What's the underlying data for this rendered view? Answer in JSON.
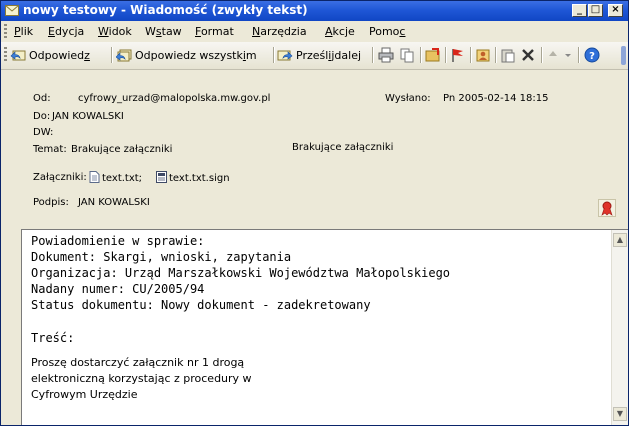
{
  "window": {
    "title": "nowy testowy - Wiadomość (zwykły tekst)",
    "controls": {
      "minimize": "_",
      "maximize": "□",
      "close": "×"
    }
  },
  "menu": [
    {
      "key": "P",
      "rest": "lik"
    },
    {
      "key": "E",
      "rest": "dycja"
    },
    {
      "key": "W",
      "rest": "idok"
    },
    {
      "pre": "W",
      "key": "s",
      "rest": "taw"
    },
    {
      "key": "F",
      "rest": "ormat"
    },
    {
      "key": "N",
      "rest": "arzędzia"
    },
    {
      "key": "A",
      "rest": "kcje"
    },
    {
      "pre": "Pomo",
      "key": "c",
      "rest": ""
    }
  ],
  "toolbar": {
    "reply": {
      "pre": "Odpowied",
      "key": "z",
      "rest": ""
    },
    "reply_all": {
      "pre": "Odpowiedz wszystk",
      "key": "i",
      "rest": "m"
    },
    "forward": {
      "pre": "Prześl",
      "key": "ij",
      "rest": " dalej"
    }
  },
  "header": {
    "from_label": "Od:",
    "from_value": "cyfrowy_urzad@malopolska.mw.gov.pl",
    "sent_label": "Wysłano:",
    "sent_value": "Pn 2005-02-14 18:15",
    "to_label": "Do:",
    "to_value": "JAN KOWALSKI",
    "cc_label": "DW:",
    "subject_label": "Temat:",
    "subject_value": "Brakujące załączniki",
    "subject_note": "Brakujące załączniki",
    "attachments_label": "Załączniki:",
    "attachments": [
      "text.txt;",
      "text.txt.sign"
    ],
    "signature_label": "Podpis:",
    "signature_value": "JAN KOWALSKI"
  },
  "body": {
    "lines": [
      "Powiadomienie w sprawie:",
      "Dokument: Skargi, wnioski, zapytania",
      "Organizacja: Urząd Marszałkowski Województwa Małopolskiego",
      "Nadany numer: CU/2005/94",
      "Status dokumentu: Nowy dokument - zadekretowany"
    ],
    "content_label": "Treść:",
    "content_lines": [
      "Proszę dostarczyć załącznik nr 1 drogą",
      "elektroniczną korzystając z procedury w",
      "Cyfrowym Urzędzie"
    ]
  },
  "colors": {
    "titlebar": "#1f57d6",
    "chrome": "#ece9d8",
    "accent_red": "#d8261a"
  }
}
